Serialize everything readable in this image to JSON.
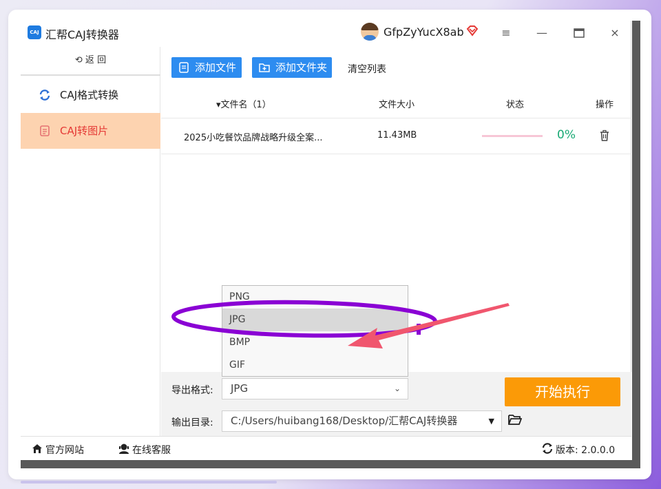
{
  "app": {
    "title": "汇帮CAJ转换器",
    "logo_text": "CAJ",
    "user_name": "GfpZyYucX8ab"
  },
  "window_controls": {
    "menu": "≡",
    "minimize": "—",
    "maximize": "□",
    "close": "×"
  },
  "sidebar": {
    "back_label": "⟲ 返 回",
    "items": [
      {
        "label": "CAJ格式转换",
        "icon": "refresh-icon",
        "active": false
      },
      {
        "label": "CAJ转图片",
        "icon": "document-icon",
        "active": true
      }
    ]
  },
  "toolbar": {
    "add_file": "添加文件",
    "add_folder": "添加文件夹",
    "clear_list": "清空列表"
  },
  "table": {
    "columns": {
      "filename": "▾文件名（1）",
      "size": "文件大小",
      "status": "状态",
      "actions": "操作"
    },
    "rows": [
      {
        "filename": "2025小吃餐饮品牌战略升级全案...",
        "size": "11.43MB",
        "progress_text": "0%",
        "progress": 0
      }
    ]
  },
  "format_dropdown": {
    "options": [
      "PNG",
      "JPG",
      "BMP",
      "GIF"
    ],
    "highlighted": "JPG"
  },
  "settings": {
    "export_format_label": "导出格式:",
    "export_format_value": "JPG",
    "output_dir_label": "输出目录:",
    "output_dir_value": "C:/Users/huibang168/Desktop/汇帮CAJ转换器"
  },
  "start_button": "开始执行",
  "footer": {
    "website": "官方网站",
    "support": "在线客服",
    "version": "版本: 2.0.0.0"
  },
  "colors": {
    "primary": "#2d8cf0",
    "accent_orange": "#fb9a07",
    "active_nav_bg": "#fdd3b0",
    "active_nav_text": "#e53935",
    "annotation_purple": "#8a00d4",
    "annotation_arrow": "#f0566e",
    "progress_text": "#19a974"
  }
}
